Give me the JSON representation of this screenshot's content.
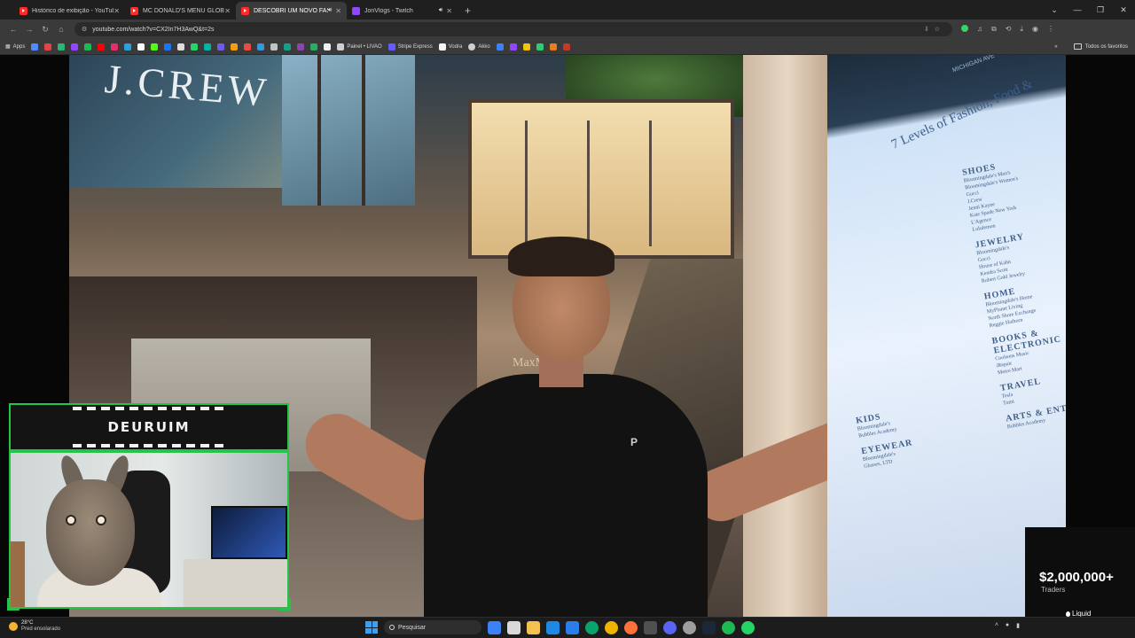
{
  "browser": {
    "tabs": [
      {
        "title": "Histórico de exibição - YouTube",
        "favicon": "youtube-icon",
        "active": false,
        "audio": false
      },
      {
        "title": "MC DONALD'S MENU GLOBAL",
        "favicon": "youtube-icon",
        "active": false,
        "audio": false
      },
      {
        "title": "DESCOBRI UM NOVO FAST FOOD",
        "favicon": "youtube-icon",
        "active": true,
        "audio": true
      },
      {
        "title": "JonVlogs - Twitch",
        "favicon": "twitch-icon",
        "active": false,
        "audio": true
      }
    ],
    "new_tab_label": "+",
    "address": "youtube.com/watch?v=CX2In7H3AwQ&t=2s",
    "bookmarks": {
      "apps_label": "Apps",
      "named": [
        "Painel • LIVAO",
        "Stripe Express",
        "Vodra",
        "Akko"
      ],
      "all_label": "Todos os favoritos"
    }
  },
  "video": {
    "store_sign": "J.CREW",
    "store_sign_lower": "MaxM",
    "directory": {
      "title": "7 Levels of Fashion, Food &",
      "street": "MICHIGAN AVE",
      "sections": [
        {
          "heading": "SHOES",
          "lines": [
            "Bloomingdale's Men's",
            "Bloomingdale's Women's",
            "Gucci",
            "J.Crew",
            "Jenni Kayne",
            "Kate Spade New York",
            "L'Agence",
            "Lululemon"
          ]
        },
        {
          "heading": "JEWELRY",
          "lines": [
            "Bloomingdale's",
            "Gucci",
            "House of Kahn",
            "Kendra Scott",
            "Robert Gold Jewelry"
          ]
        },
        {
          "heading": "HOME",
          "lines": [
            "Bloomingdale's Home",
            "MyPlanet Living",
            "North Shore Exchange",
            "Reggie Hathorn"
          ]
        },
        {
          "heading": "BOOKS & ELECTRONIC",
          "lines": [
            "Coolsons Music",
            "iRepair",
            "Metro Mart"
          ]
        },
        {
          "heading": "TRAVEL",
          "lines": [
            "Tesla",
            "Tumi"
          ]
        },
        {
          "heading": "ARTS & ENTERTA",
          "lines": [
            "Bubbles Academy"
          ]
        },
        {
          "heading": "KIDS",
          "lines": [
            "Bloomingdale's",
            "Bubbles Academy"
          ]
        },
        {
          "heading": "EYEWEAR",
          "lines": [
            "Bloomingdale's",
            "Glasses, LTD"
          ]
        }
      ]
    },
    "shirt_logo": "P"
  },
  "webcam": {
    "streamer_name": "DEURUIM",
    "accent_color": "#23c447"
  },
  "ad": {
    "amount": "$2,000,000+",
    "subtitle": "Traders",
    "brand": "Liquid"
  },
  "taskbar": {
    "weather_temp": "28°C",
    "weather_condition": "Pred ensolarado",
    "search_label": "Pesquisar"
  },
  "colors": {
    "tab_active_bg": "#3a3a3a",
    "youtube_red": "#ff2a2a",
    "twitch_purple": "#9146ff",
    "overlay_green": "#23c447"
  }
}
